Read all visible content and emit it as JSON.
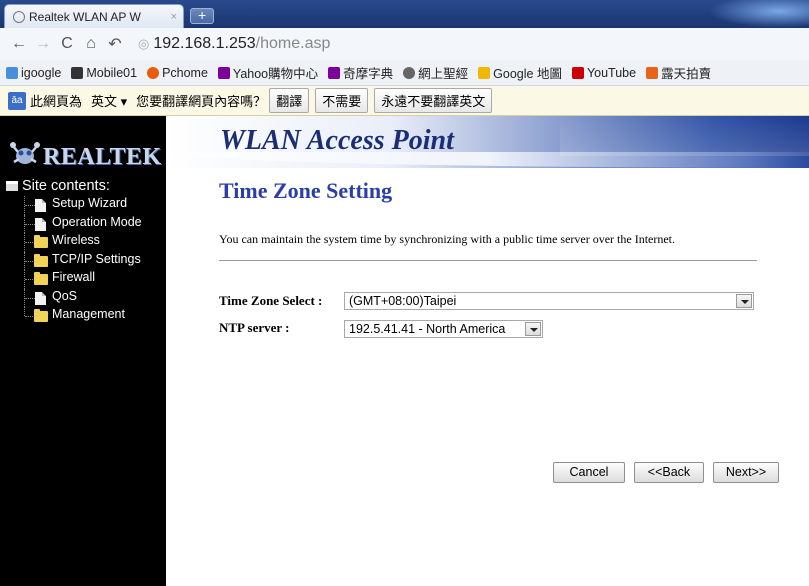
{
  "browser": {
    "tab_title": "Realtek WLAN AP W",
    "url_host": "192.168.1.253",
    "url_path": "/home.asp",
    "bookmarks": [
      {
        "label": "igoogle",
        "color": "#4a90d9"
      },
      {
        "label": "Mobile01",
        "color": "#333333"
      },
      {
        "label": "Pchome",
        "color": "#e85d0c"
      },
      {
        "label": "Yahoo購物中心",
        "color": "#7b0099"
      },
      {
        "label": "奇摩字典",
        "color": "#7b0099"
      },
      {
        "label": "網上聖經",
        "color": "#444444"
      },
      {
        "label": "Google 地圖",
        "color": "#f2b705"
      },
      {
        "label": "YouTube",
        "color": "#cc0000"
      },
      {
        "label": "露天拍賣",
        "color": "#e8641b"
      }
    ],
    "translate": {
      "prefix": "此網頁為",
      "language": "英文",
      "question": "您要翻譯網頁內容嗎？",
      "translate_btn": "翻譯",
      "no_btn": "不需要",
      "never_btn": "永遠不要翻譯英文"
    }
  },
  "sidebar": {
    "logo_text": "REALTEK",
    "tree_title": "Site contents:",
    "items": [
      {
        "label": "Setup Wizard",
        "icon": "page"
      },
      {
        "label": "Operation Mode",
        "icon": "page"
      },
      {
        "label": "Wireless",
        "icon": "folder"
      },
      {
        "label": "TCP/IP Settings",
        "icon": "folder"
      },
      {
        "label": "Firewall",
        "icon": "folder"
      },
      {
        "label": "QoS",
        "icon": "page"
      },
      {
        "label": "Management",
        "icon": "folder"
      }
    ]
  },
  "header": {
    "title": "WLAN Access Point"
  },
  "main": {
    "page_title": "Time Zone Setting",
    "description": "You can maintain the system time by synchronizing with a public time server over the Internet.",
    "tz_label": "Time Zone Select :",
    "tz_value": "(GMT+08:00)Taipei",
    "ntp_label": "NTP server :",
    "ntp_value": "192.5.41.41 - North America",
    "buttons": {
      "cancel": "Cancel",
      "back": "<<Back",
      "next": "Next>>"
    }
  },
  "colors": {
    "title_blue": "#2a3ea8",
    "banner_dark": "#1c3a8e",
    "sidebar_bg": "#000000"
  }
}
